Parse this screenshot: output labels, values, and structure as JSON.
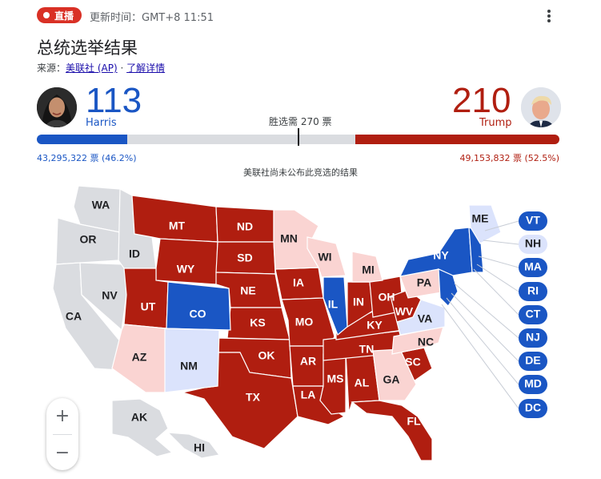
{
  "header": {
    "live_label": "直播",
    "updated": "更新时间：GMT+8 11:51",
    "title": "总统选举结果",
    "source_prefix": "来源：",
    "source_name": "美联社 (AP)",
    "source_sep": " · ",
    "source_link": "了解详情"
  },
  "race": {
    "harris": {
      "name": "Harris",
      "electoral_votes": "113",
      "popular_votes": "43,295,322 票 (46.2%)",
      "share": 0.173
    },
    "trump": {
      "name": "Trump",
      "electoral_votes": "210",
      "popular_votes": "49,153,832 票 (52.5%)",
      "share": 0.39
    },
    "to_win": "胜选需 270 票",
    "notice": "美联社尚未公布此竞选的结果"
  },
  "colors": {
    "dem_called": "#1a56c4",
    "rep_called": "#b01e10",
    "dem_lean": "#dbe3fc",
    "rep_lean": "#fad4d2",
    "uncalled": "#dadce0"
  },
  "states": {
    "WA": "WA",
    "OR": "OR",
    "CA": "CA",
    "NV": "NV",
    "ID": "ID",
    "MT": "MT",
    "WY": "WY",
    "UT": "UT",
    "AZ": "AZ",
    "CO": "CO",
    "NM": "NM",
    "ND": "ND",
    "SD": "SD",
    "NE": "NE",
    "KS": "KS",
    "OK": "OK",
    "TX": "TX",
    "MN": "MN",
    "IA": "IA",
    "MO": "MO",
    "AR": "AR",
    "LA": "LA",
    "WI": "WI",
    "IL": "IL",
    "MI": "MI",
    "IN": "IN",
    "OH": "OH",
    "KY": "KY",
    "TN": "TN",
    "MS": "MS",
    "AL": "AL",
    "GA": "GA",
    "FL": "FL",
    "SC": "SC",
    "NC": "NC",
    "VA": "VA",
    "WV": "WV",
    "PA": "PA",
    "NY": "NY",
    "ME": "ME",
    "AK": "AK",
    "HI": "HI"
  },
  "small_states": {
    "VT": "VT",
    "NH": "NH",
    "MA": "MA",
    "RI": "RI",
    "CT": "CT",
    "NJ": "NJ",
    "DE": "DE",
    "MD": "MD",
    "DC": "DC"
  },
  "zoom": {
    "in": "+",
    "out": "−"
  }
}
